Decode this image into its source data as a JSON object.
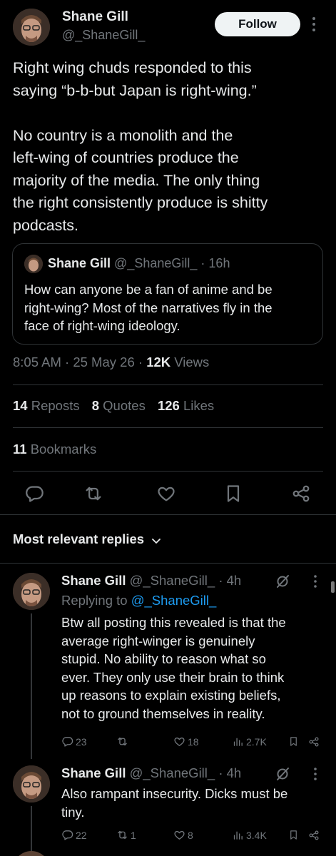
{
  "tweet": {
    "author_name": "Shane Gill",
    "author_handle": "@_ShaneGill_",
    "follow_label": "Follow",
    "text_line1": "Right wing chuds responded to this",
    "text_line2": "saying “b-b-but Japan is right-wing.”",
    "text_line3": "No country is a monolith and the",
    "text_line4": "left-wing of countries produce the",
    "text_line5": "majority of the media. The only thing",
    "text_line6": "the right consistently produce is shitty",
    "text_line7": "podcasts.",
    "quote": {
      "author_name": "Shane Gill",
      "author_handle": "@_ShaneGill_",
      "sep": "·",
      "time": "16h",
      "line1": "How can anyone be a fan of anime and be",
      "line2": "right-wing? Most of the narratives fly in the",
      "line3": "face of right-wing ideology."
    },
    "time": "8:05 AM",
    "dot1": "·",
    "date": "25 May 26",
    "dot2": "·",
    "views_count": "12K",
    "views_label": "Views",
    "reposts_count": "14",
    "reposts_label": "Reposts",
    "quotes_count": "8",
    "quotes_label": "Quotes",
    "likes_count": "126",
    "likes_label": "Likes",
    "bookmarks_count": "11",
    "bookmarks_label": "Bookmarks"
  },
  "replies_sort_label": "Most relevant replies",
  "replies": [
    {
      "author_name": "Shane Gill",
      "author_handle": "@_ShaneGill_",
      "sep": "·",
      "time": "4h",
      "replying_prefix": "Replying to",
      "replying_handle": "@_ShaneGill_",
      "line1": "Btw all posting this revealed is that the",
      "line2": "average right-winger is genuinely",
      "line3": "stupid. No ability to reason what so",
      "line4": "ever. They only use their brain to think",
      "line5": "up reasons to explain existing beliefs,",
      "line6": "not to ground themselves in reality.",
      "replies_count": "23",
      "reposts_count": "",
      "likes_count": "18",
      "views_count": "2.7K"
    },
    {
      "author_name": "Shane Gill",
      "author_handle": "@_ShaneGill_",
      "sep": "·",
      "time": "4h",
      "line1": "Also rampant insecurity. Dicks must be",
      "line2": "tiny.",
      "replies_count": "22",
      "reposts_count": "1",
      "likes_count": "8",
      "views_count": "3.4K"
    }
  ],
  "icons": {
    "more": "more-icon",
    "reply": "reply-icon",
    "repost": "repost-icon",
    "like": "heart-icon",
    "bookmark": "bookmark-icon",
    "share": "share-icon",
    "views": "views-icon",
    "grok": "grok-icon",
    "chevron": "chevron-down-icon"
  },
  "colors": {
    "background": "#000000",
    "text": "#e7e9ea",
    "muted": "#71767b",
    "accent": "#1d9bf0",
    "border": "#2f3336"
  }
}
